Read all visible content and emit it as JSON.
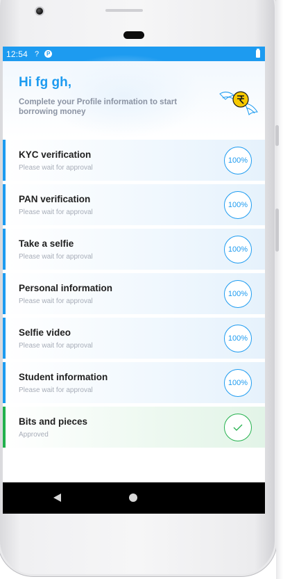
{
  "status_bar": {
    "time": "12:54",
    "icons": [
      "wifi-question-icon",
      "badge-icon",
      "battery-icon"
    ],
    "color": "#1d9bf0"
  },
  "header": {
    "greeting": "Hi fg gh,",
    "subtitle": "Complete your Profile information to start borrowing money",
    "mascot": "flying-coin-icon"
  },
  "steps": [
    {
      "title": "KYC verification",
      "status": "Please wait for approval",
      "progress": "100%"
    },
    {
      "title": "PAN verification",
      "status": "Please wait for approval",
      "progress": "100%"
    },
    {
      "title": "Take a selfie",
      "status": "Please wait for approval",
      "progress": "100%"
    },
    {
      "title": "Personal information",
      "status": "Please wait for approval",
      "progress": "100%"
    },
    {
      "title": "Selfie video",
      "status": "Please wait for approval",
      "progress": "100%"
    },
    {
      "title": "Student information",
      "status": "Please wait for approval",
      "progress": "100%"
    },
    {
      "title": "Bits and pieces",
      "status": "Approved",
      "icon": "check-icon"
    }
  ],
  "nav_bar": {
    "back": "back-triangle-icon",
    "home": "home-circle-icon"
  },
  "colors": {
    "accent": "#1d9bf0",
    "approved": "#23b14d",
    "subtle_text": "#a7adb8"
  }
}
